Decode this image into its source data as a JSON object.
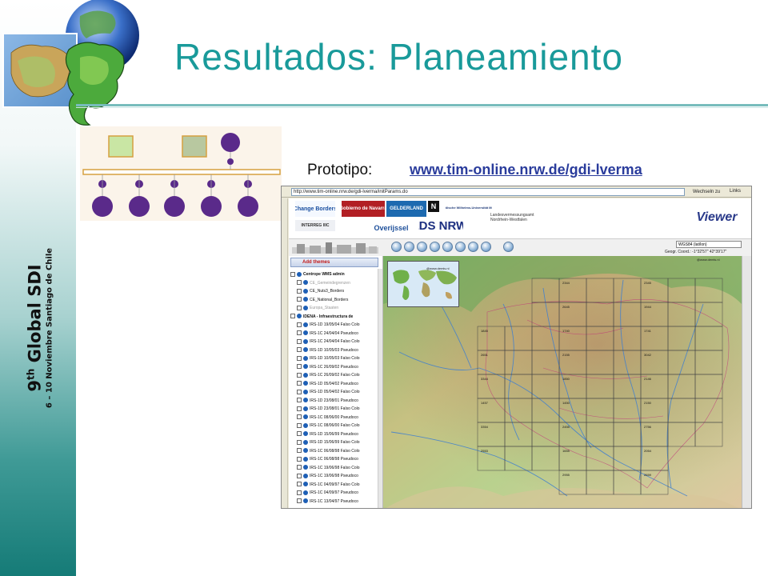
{
  "slide": {
    "title": "Resultados: Planeamiento",
    "vertical_title_main": "Global SDI",
    "vertical_title_ordinal_num": "9",
    "vertical_title_ordinal_suffix": "th",
    "vertical_subtitle": "6 – 10 Noviembre Santiago de Chile"
  },
  "prototype": {
    "label": "Prototipo:",
    "link_text": "www.tim-online.nrw.de/gdi-lverma"
  },
  "browser": {
    "address_label": "http",
    "address_value": "http://www.tim-online.nrw.de/gdi-lverma/initParams.do",
    "go_label": "Wechseln zu",
    "links_label": "Links"
  },
  "banner_logos": {
    "change": "Change Borders",
    "interreg": "INTERREG IIIC",
    "navarra": "Gobierno de Navarra",
    "gelderland": "GELDERLAND",
    "n_logo": "N",
    "university": "Westfälische Wilhelms-Universität Münster",
    "overijssel": "Overijssel",
    "lds_nrw": "LDS NRW.",
    "landesvermessung_line1": "Landesvermessungsamt",
    "landesvermessung_line2": "Nordrhein-Westfalen",
    "viewer": "Viewer"
  },
  "toolbar": {
    "crs_value": "WGS84 (lat/lon)",
    "coord_readout": "Geogr. Coord.: -1°32'57\" 42°39'17\""
  },
  "themes": {
    "add_label": "Add themes",
    "items": [
      {
        "label": "Centrope WMS admin",
        "group": true,
        "grey": false
      },
      {
        "label": "CE_Gemeindegrenzen",
        "group": false,
        "grey": true
      },
      {
        "label": "CE_Nuts3_Borders",
        "group": false,
        "grey": false
      },
      {
        "label": "CE_National_Borders",
        "group": false,
        "grey": false
      },
      {
        "label": "Europa_Staaten",
        "group": false,
        "grey": true
      },
      {
        "label": "IDENA - Infraestructura de",
        "group": true,
        "grey": false
      },
      {
        "label": "IRS-1D 19/05/04 Falso Colo",
        "group": false,
        "grey": false
      },
      {
        "label": "IRS-1C 24/04/04 Pseudoco",
        "group": false,
        "grey": false
      },
      {
        "label": "IRS-1C 24/04/04 Falso Colo",
        "group": false,
        "grey": false
      },
      {
        "label": "IRS-1D 10/05/03 Pseudoco",
        "group": false,
        "grey": false
      },
      {
        "label": "IRS-1D 10/05/03 Falso Colo",
        "group": false,
        "grey": false
      },
      {
        "label": "IRS-1C 26/09/02 Pseudoco",
        "group": false,
        "grey": false
      },
      {
        "label": "IRS-1C 26/09/02 Falso Colo",
        "group": false,
        "grey": false
      },
      {
        "label": "IRS-1D 05/04/02 Pseudoco",
        "group": false,
        "grey": false
      },
      {
        "label": "IRS-1D 05/04/02 Falso Colo",
        "group": false,
        "grey": false
      },
      {
        "label": "IRS-1D 23/08/01 Pseudoco",
        "group": false,
        "grey": false
      },
      {
        "label": "IRS-1D 23/08/01 Falso Colo",
        "group": false,
        "grey": false
      },
      {
        "label": "IRS-1C 08/06/00 Pseudoco",
        "group": false,
        "grey": false
      },
      {
        "label": "IRS-1C 08/06/00 Falso Colo",
        "group": false,
        "grey": false
      },
      {
        "label": "IRS-1D 15/06/99 Pseudoco",
        "group": false,
        "grey": false
      },
      {
        "label": "IRS-1D 15/06/99 Falso Colo",
        "group": false,
        "grey": false
      },
      {
        "label": "IRS-1C 06/08/98 Falso Colo",
        "group": false,
        "grey": false
      },
      {
        "label": "IRS-1C 06/08/98 Pseudoco",
        "group": false,
        "grey": false
      },
      {
        "label": "IRS-1C 19/06/98 Falso Colo",
        "group": false,
        "grey": false
      },
      {
        "label": "IRS-1C 19/06/98 Pseudoco",
        "group": false,
        "grey": false
      },
      {
        "label": "IRS-1C 04/09/97 Falso Colo",
        "group": false,
        "grey": false
      },
      {
        "label": "IRS-1C 04/09/97 Pseudoco",
        "group": false,
        "grey": false
      },
      {
        "label": "IRS-1C 13/04/97 Pseudoco",
        "group": false,
        "grey": false
      }
    ]
  },
  "map": {
    "overview_credit": "@www.demis.nl",
    "map_credit": "@www.demis.nl",
    "tile_labels": [
      "2344",
      "2345",
      "2645",
      "1944",
      "1845",
      "1740",
      "1741",
      "2651",
      "2155",
      "3042",
      "3344",
      "1850",
      "2146",
      "1457",
      "1450",
      "2150",
      "3354",
      "2455",
      "2756",
      "2553",
      "1655",
      "2054",
      "2955",
      "2659",
      "3151",
      "3356",
      "2451",
      "3351",
      "2866",
      "2365",
      "2261"
    ]
  },
  "colors": {
    "title": "#199a9a",
    "link": "#2a3c9c",
    "sidebar_dark": "#157b77"
  }
}
